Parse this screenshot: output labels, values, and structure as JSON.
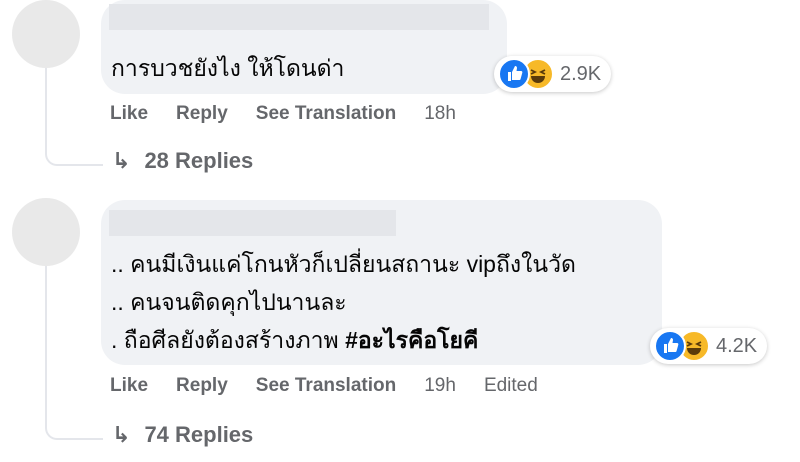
{
  "comments": [
    {
      "lines": [
        "การบวชยังไง ให้โดนด่า"
      ],
      "hashtag": "",
      "reactions": {
        "icons": [
          "like-icon",
          "haha-icon"
        ],
        "count": "2.9K"
      },
      "actions": {
        "like": "Like",
        "reply": "Reply",
        "translate": "See Translation",
        "time": "18h",
        "edited": ""
      },
      "replies": {
        "arrow": "↳",
        "label": "28 Replies"
      }
    },
    {
      "lines": [
        ".. คนมีเงินแค่โกนหัวก็เปลี่ยนสถานะ vipถึงในวัด",
        ".. คนจนติดคุกไปนานละ",
        ". ถือศีลยังต้องสร้างภาพ "
      ],
      "hashtag": "#อะไรคือโยคี",
      "reactions": {
        "icons": [
          "like-icon",
          "haha-icon"
        ],
        "count": "4.2K"
      },
      "actions": {
        "like": "Like",
        "reply": "Reply",
        "translate": "See Translation",
        "time": "19h",
        "edited": "Edited"
      },
      "replies": {
        "arrow": "↳",
        "label": "74 Replies"
      }
    }
  ],
  "colors": {
    "bubble": "#f0f2f5",
    "meta": "#65676b",
    "like": "#1877f2",
    "haha": "#f7b928"
  }
}
